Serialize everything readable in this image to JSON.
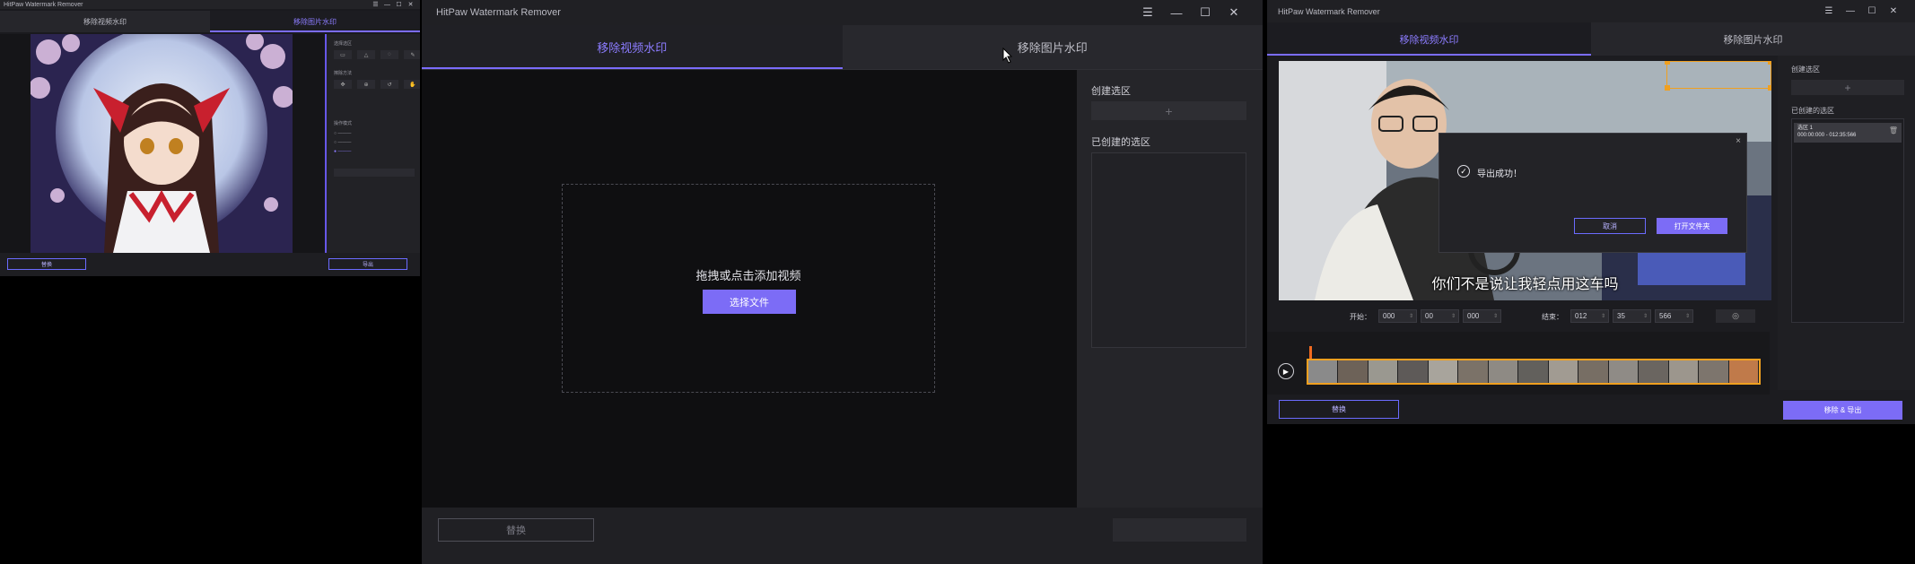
{
  "app_title": "HitPaw Watermark Remover",
  "tabs": {
    "video": "移除视频水印",
    "image": "移除图片水印"
  },
  "window_controls": {
    "menu": "☰",
    "minimize": "—",
    "maximize": "☐",
    "close": "✕"
  },
  "small_window": {
    "title": "HitPaw Watermark Remover",
    "panel_labels": [
      "选择选区",
      "擦除方法",
      "操作模式"
    ],
    "bottom_left_button": "替换",
    "bottom_right_button": "导出"
  },
  "center_window": {
    "drop_prompt": "拖拽或点击添加视频",
    "select_file_button": "选择文件",
    "create_selection_label": "创建选区",
    "created_selection_label": "已创建的选区",
    "add_symbol": "+",
    "replace_button": "替换"
  },
  "right_window": {
    "subtitle": "你们不是说让我轻点用这车吗",
    "dialog": {
      "message": "导出成功！",
      "cancel_button": "取消",
      "open_folder_button": "打开文件夹",
      "close_symbol": "×",
      "check_symbol": "✓"
    },
    "time": {
      "start_label": "开始：",
      "end_label": "结束：",
      "start_h": "000",
      "start_m": "00",
      "start_s": "000",
      "end_h": "012",
      "end_m": "35",
      "end_s": "566"
    },
    "create_selection_label": "创建选区",
    "created_selection_label": "已创建的选区",
    "add_symbol": "+",
    "selection_item_name": "选区 1",
    "selection_item_range": "000:00:000 - 012:35:566",
    "replace_button": "替换",
    "export_button": "移除 & 导出",
    "play_symbol": "▶"
  },
  "colors": {
    "accent": "#7c6cf6",
    "accent_text": "#8c7cff",
    "selection_border": "#f0a020"
  }
}
